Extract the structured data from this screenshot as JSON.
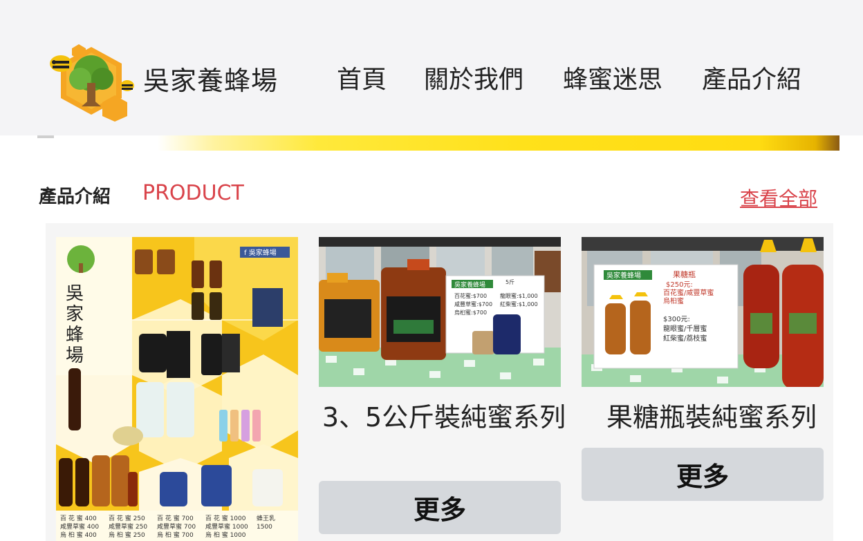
{
  "header": {
    "brand": "吳家養蜂場",
    "nav": [
      "首頁",
      "關於我們",
      "蜂蜜迷思",
      "產品介紹"
    ]
  },
  "section": {
    "title": "產品介紹",
    "subtitle": "PRODUCT",
    "view_all": "查看全部"
  },
  "products": [
    {
      "title": "",
      "image": "product-price-list-poster"
    },
    {
      "title": "3、5公斤裝純蜜系列",
      "button": "更多",
      "image": "honey-jugs-photo"
    },
    {
      "title": "果糖瓶裝純蜜系列",
      "button": "更多",
      "image": "squeeze-bottles-photo"
    }
  ],
  "poster": {
    "brand_vertical": "吳家蜂場",
    "fb_label": "吳家蜂場"
  },
  "photo1": {
    "sign_title": "吳家養蜂場",
    "sign_lines": [
      "5斤",
      "百花蜜:$700",
      "咸豐草蜜:$700",
      "烏桕蜜:$700",
      "龍眼蜜:$1,000",
      "紅柴蜜:$1,000"
    ]
  },
  "photo2": {
    "sign_title": "吳家養蜂場",
    "sign_heading": "果糖瓶",
    "sign_lines": [
      "$250元:",
      "百花蜜/咸豐草蜜",
      "烏桕蜜",
      "$300元:",
      "龍眼蜜/千層蜜",
      "紅柴蜜/荔枝蜜"
    ]
  },
  "colors": {
    "accent": "#d9434a",
    "header_bg": "#f4f4f6",
    "button_bg": "#d5d8dc"
  }
}
